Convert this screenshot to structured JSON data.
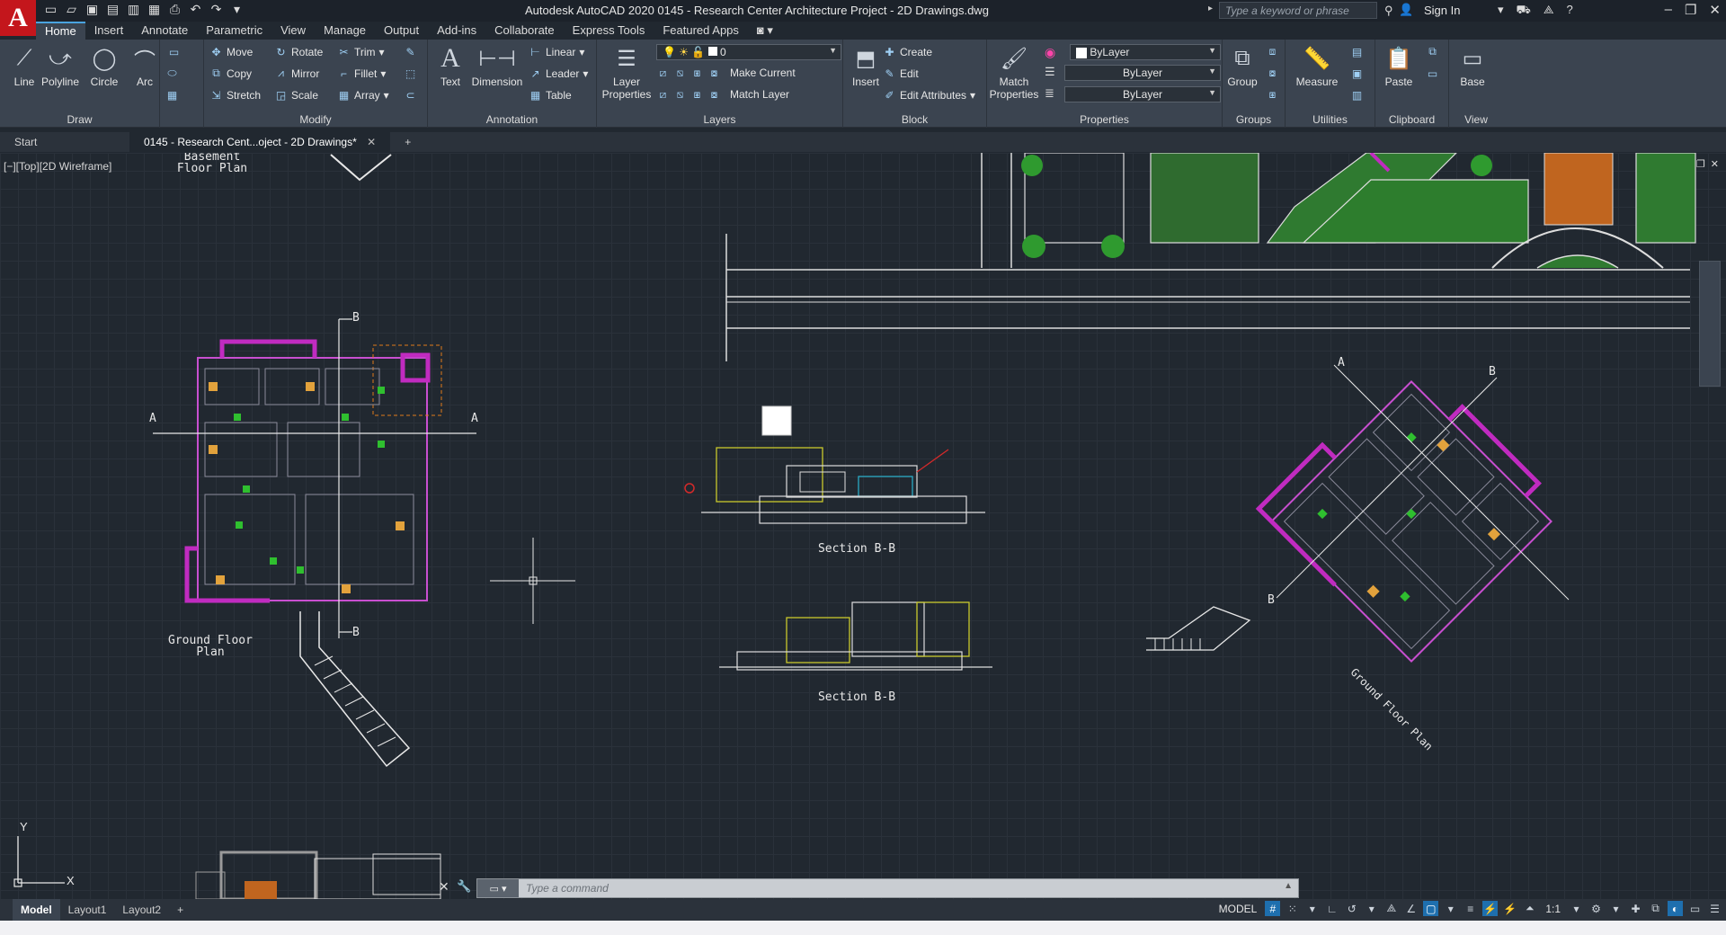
{
  "app": {
    "logo": "A",
    "window_title": "Autodesk AutoCAD 2020   0145 - Research Center  Architecture Project - 2D Drawings.dwg",
    "search_placeholder": "Type a keyword or phrase",
    "signin_label": "Sign In"
  },
  "menu": {
    "tabs": [
      "Home",
      "Insert",
      "Annotate",
      "Parametric",
      "View",
      "Manage",
      "Output",
      "Add-ins",
      "Collaborate",
      "Express Tools",
      "Featured Apps"
    ]
  },
  "ribbon": {
    "draw": {
      "label": "Draw",
      "line": "Line",
      "polyline": "Polyline",
      "circle": "Circle",
      "arc": "Arc"
    },
    "modify": {
      "label": "Modify",
      "move": "Move",
      "rotate": "Rotate",
      "trim": "Trim",
      "copy": "Copy",
      "mirror": "Mirror",
      "fillet": "Fillet",
      "stretch": "Stretch",
      "scale": "Scale",
      "array": "Array"
    },
    "annotation": {
      "label": "Annotation",
      "text": "Text",
      "dimension": "Dimension",
      "linear": "Linear",
      "leader": "Leader",
      "table": "Table"
    },
    "layers": {
      "label": "Layers",
      "layer_properties": "Layer Properties",
      "current_layer": "0",
      "make_current": "Make Current",
      "match_layer": "Match Layer"
    },
    "block": {
      "label": "Block",
      "insert": "Insert",
      "create": "Create",
      "edit": "Edit",
      "edit_attributes": "Edit Attributes"
    },
    "properties": {
      "label": "Properties",
      "match_properties": "Match Properties",
      "color": "ByLayer",
      "linetype": "ByLayer",
      "lineweight": "ByLayer"
    },
    "groups": {
      "label": "Groups",
      "group": "Group"
    },
    "utilities": {
      "label": "Utilities",
      "measure": "Measure"
    },
    "clipboard": {
      "label": "Clipboard",
      "paste": "Paste"
    },
    "view": {
      "label": "View",
      "base": "Base"
    }
  },
  "doc_tabs": {
    "start": "Start",
    "active": "0145 - Research Cent...oject - 2D Drawings*"
  },
  "viewport": {
    "label": "[−][Top][2D Wireframe]",
    "texts": {
      "basement": "Basement\nFloor Plan",
      "ground_floor": "Ground Floor\nPlan",
      "section1": "Section B-B",
      "section2": "Section B-B",
      "rotated_ground": "Ground Floor Plan",
      "marker_b": "B",
      "marker_a": "A",
      "ucs_y": "Y",
      "ucs_x": "X"
    }
  },
  "command": {
    "placeholder": "Type a command"
  },
  "status": {
    "layouts": [
      "Model",
      "Layout1",
      "Layout2"
    ],
    "model_label": "MODEL",
    "scale": "1:1"
  }
}
